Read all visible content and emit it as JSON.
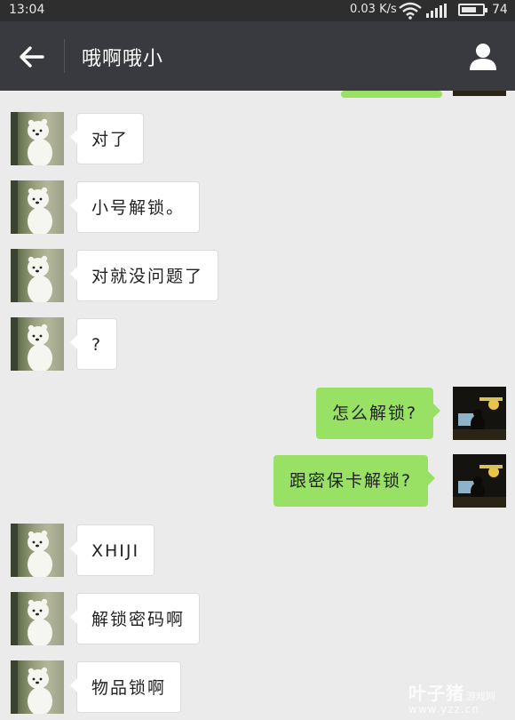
{
  "status_bar": {
    "time": "13:04",
    "net_speed": "0.03 K/s",
    "battery_level": "74",
    "battery_fraction": 0.74
  },
  "header": {
    "title": "哦啊哦小",
    "back_icon": "arrow-left-icon",
    "profile_icon": "person-icon"
  },
  "messages": [
    {
      "from": "me",
      "text": "",
      "partial": true
    },
    {
      "from": "other",
      "text": "对了"
    },
    {
      "from": "other",
      "text": "小号解锁。"
    },
    {
      "from": "other",
      "text": "对就没问题了"
    },
    {
      "from": "other",
      "text": "?"
    },
    {
      "from": "me",
      "text": "怎么解锁?"
    },
    {
      "from": "me",
      "text": "跟密保卡解锁?"
    },
    {
      "from": "other",
      "text": "XHIJI"
    },
    {
      "from": "other",
      "text": "解锁密码啊"
    },
    {
      "from": "other",
      "text": "物品锁啊"
    }
  ],
  "watermark": {
    "name": "叶子猪",
    "sub": "游戏网",
    "url": "www.yzz.cn"
  },
  "colors": {
    "header_bg": "#393a3f",
    "chat_bg": "#ebebeb",
    "bubble_out": "#98e165",
    "bubble_in": "#ffffff"
  }
}
